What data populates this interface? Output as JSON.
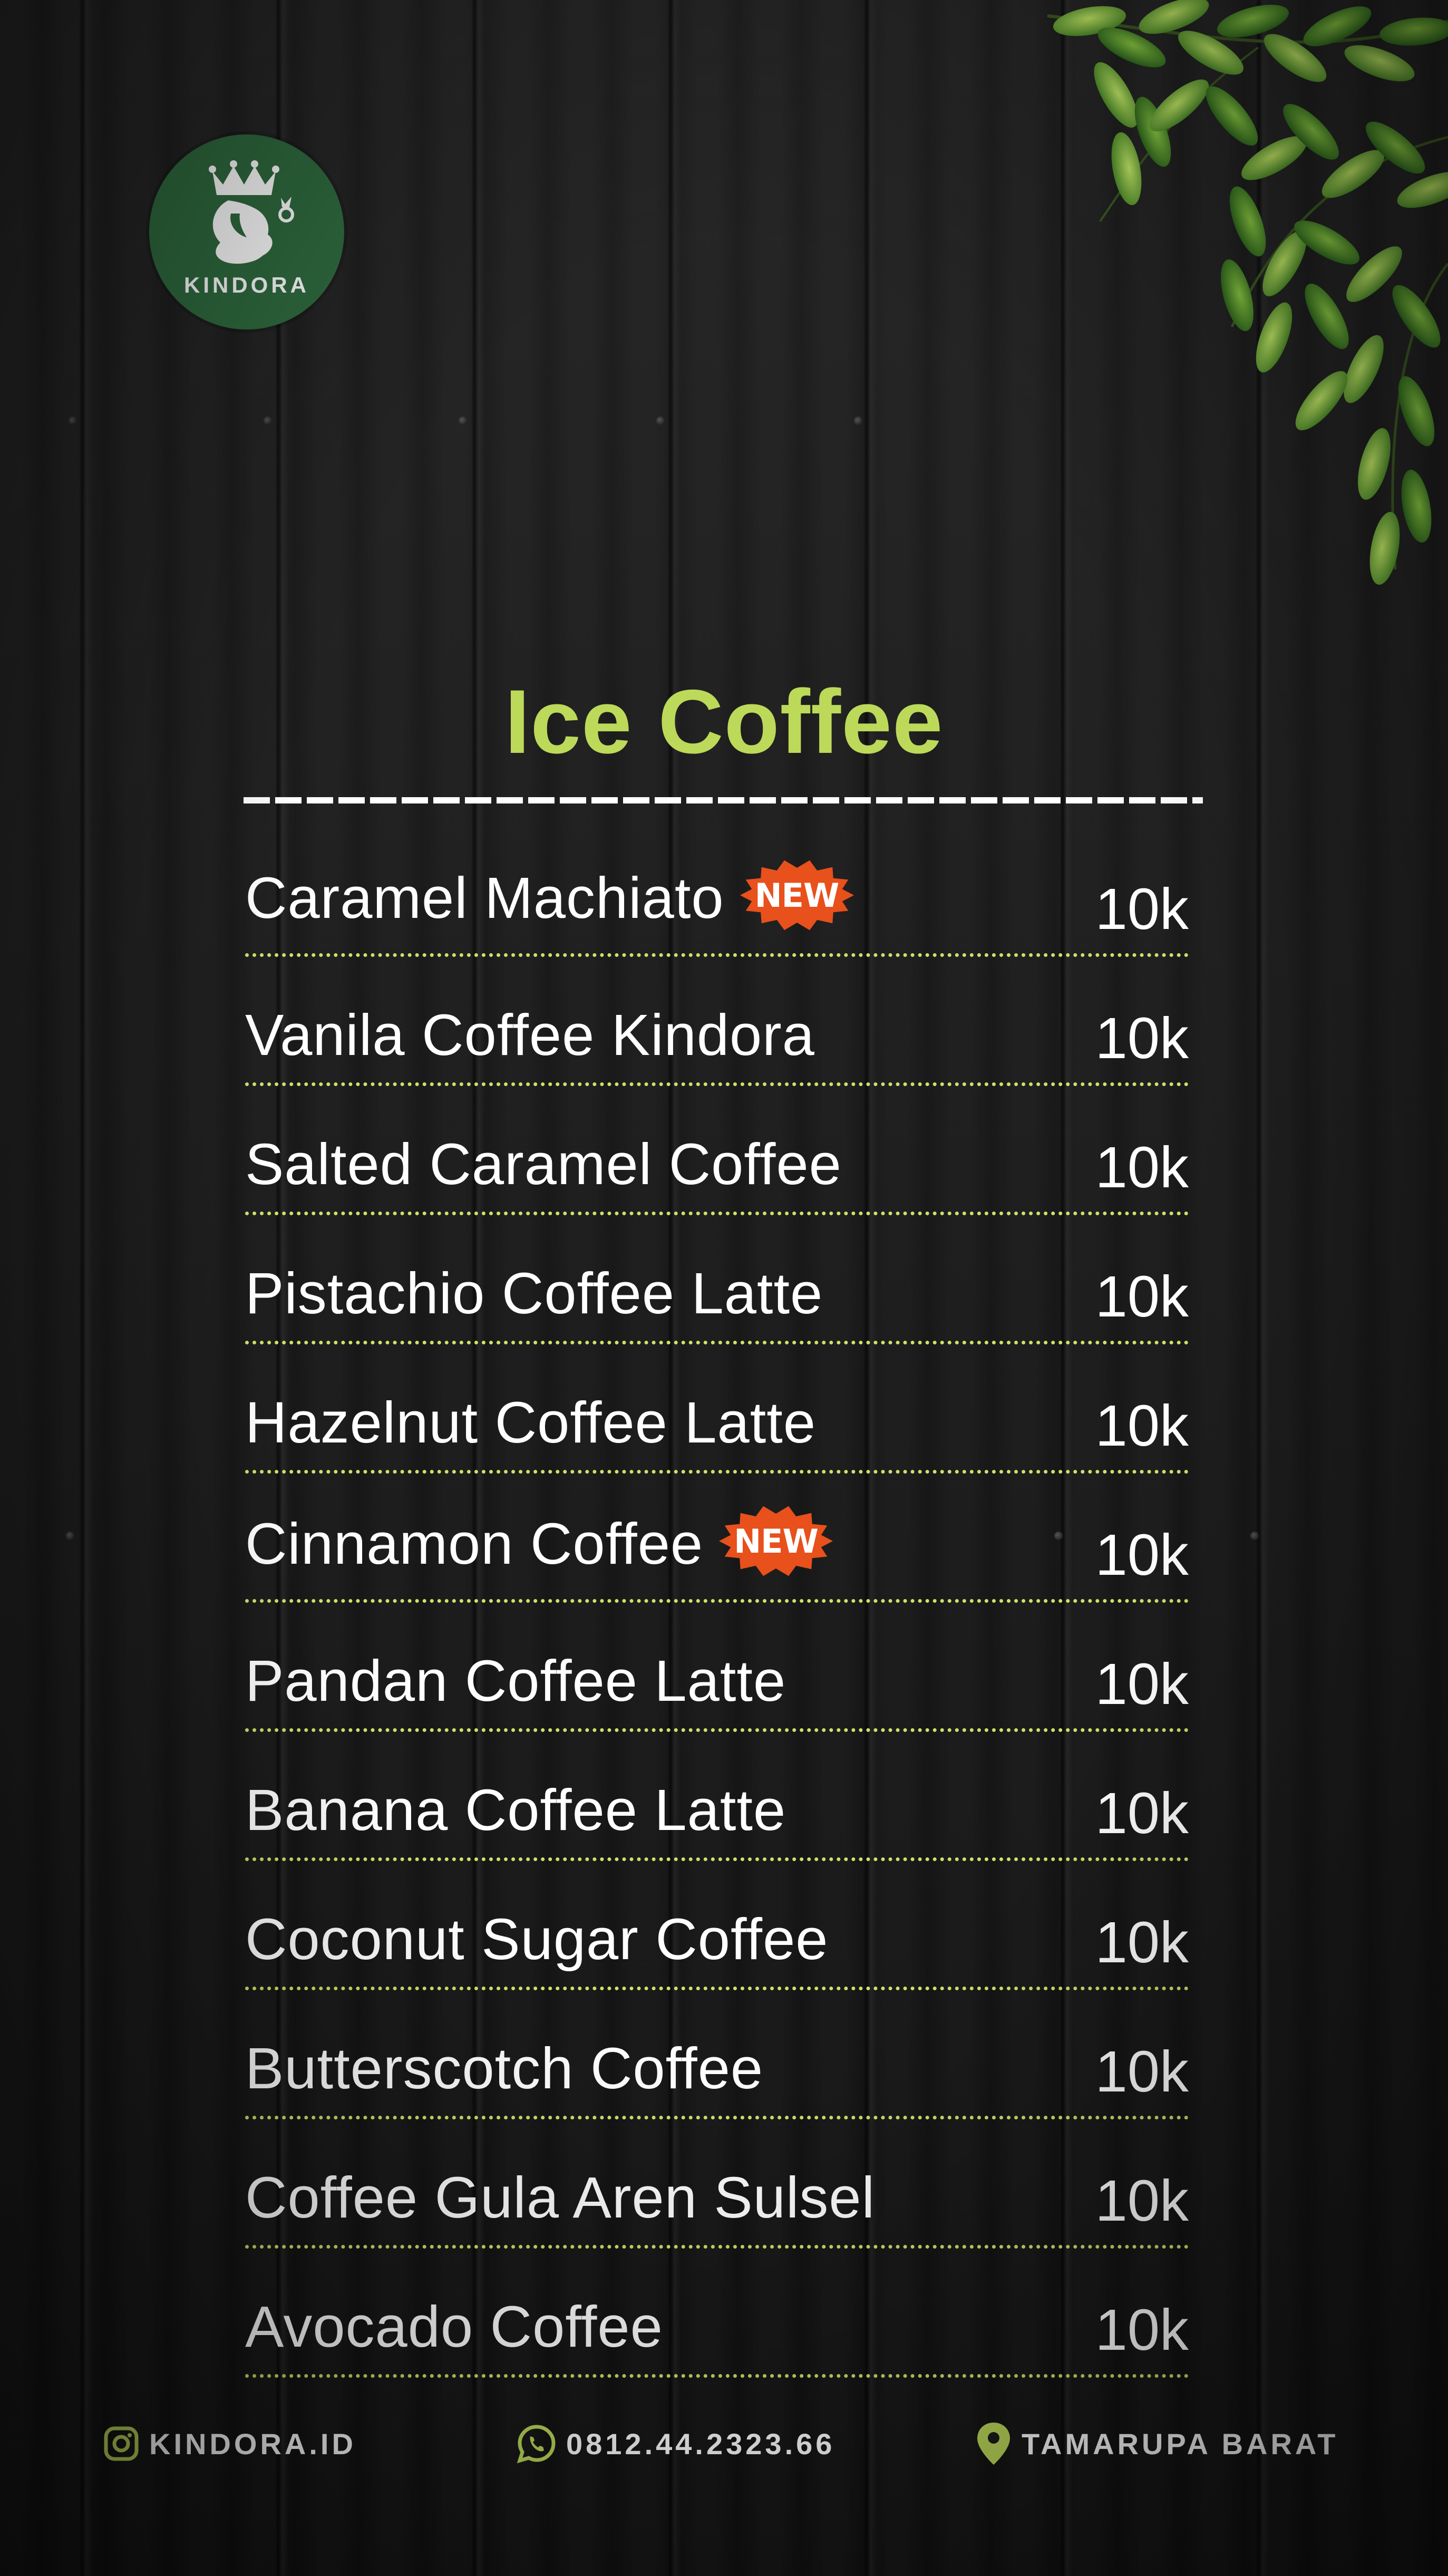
{
  "brand": {
    "logo_text": "KINDORA"
  },
  "menu": {
    "title": "Ice Coffee",
    "badge_label": "NEW",
    "items": [
      {
        "name": "Caramel Machiato",
        "price": "10k",
        "badge": true
      },
      {
        "name": "Vanila Coffee Kindora",
        "price": "10k",
        "badge": false
      },
      {
        "name": "Salted Caramel Coffee",
        "price": "10k",
        "badge": false
      },
      {
        "name": "Pistachio Coffee Latte",
        "price": "10k",
        "badge": false
      },
      {
        "name": "Hazelnut Coffee Latte",
        "price": "10k",
        "badge": false
      },
      {
        "name": "Cinnamon Coffee",
        "price": "10k",
        "badge": true
      },
      {
        "name": "Pandan Coffee Latte",
        "price": "10k",
        "badge": false
      },
      {
        "name": "Banana Coffee Latte",
        "price": "10k",
        "badge": false
      },
      {
        "name": "Coconut Sugar Coffee",
        "price": "10k",
        "badge": false
      },
      {
        "name": "Butterscotch Coffee",
        "price": "10k",
        "badge": false
      },
      {
        "name": "Coffee Gula Aren Sulsel",
        "price": "10k",
        "badge": false
      },
      {
        "name": "Avocado Coffee",
        "price": "10k",
        "badge": false
      }
    ]
  },
  "footer": {
    "instagram": {
      "icon": "instagram-icon",
      "text": "KINDORA.ID"
    },
    "whatsapp": {
      "icon": "whatsapp-icon",
      "text": "0812.44.2323.66"
    },
    "location": {
      "icon": "location-pin-icon",
      "text": "TAMARUPA BARAT"
    }
  },
  "colors": {
    "accent": "#bcd95a",
    "badge": "#e8501c",
    "logo_bg": "#2f6b3f",
    "text": "#ffffff",
    "background": "#1b1b1b"
  }
}
